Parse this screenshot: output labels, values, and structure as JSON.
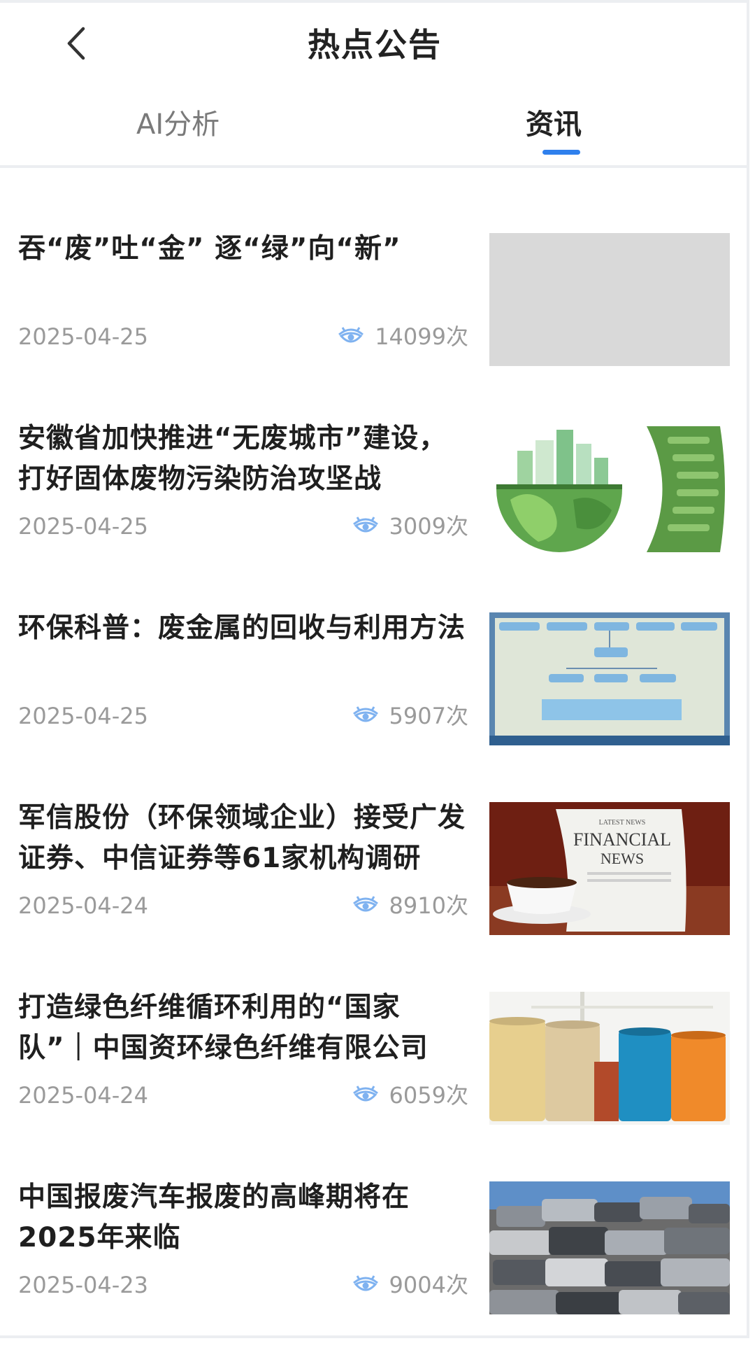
{
  "header": {
    "title": "热点公告",
    "back_icon": "chevron-left-icon"
  },
  "tabs": [
    {
      "label": "AI分析",
      "active": false
    },
    {
      "label": "资讯",
      "active": true
    }
  ],
  "colors": {
    "accent": "#2f80ed",
    "title_text": "#1f1f1f",
    "meta_text": "#9a9a9a"
  },
  "news": [
    {
      "title": "吞“废”吐“金” 逐“绿”向“新”",
      "date": "2025-04-25",
      "views": "14099次",
      "thumbnail": "blank-placeholder"
    },
    {
      "title": "安徽省加快推进“无废城市”建设，打好固体废物污染防治攻坚战",
      "date": "2025-04-25",
      "views": "3009次",
      "thumbnail": "green-globe-city-illustration"
    },
    {
      "title": "环保科普：废金属的回收与利用方法",
      "date": "2025-04-25",
      "views": "5907次",
      "thumbnail": "flowchart-diagram"
    },
    {
      "title": "军信股份（环保领域企业）接受广发证券、中信证券等61家机构调研",
      "date": "2025-04-24",
      "views": "8910次",
      "thumbnail": "financial-news-coffee"
    },
    {
      "title": "打造绿色纤维循环利用的“国家队”｜中国资环绿色纤维有限公司",
      "date": "2025-04-24",
      "views": "6059次",
      "thumbnail": "yarn-spools"
    },
    {
      "title": "中国报废汽车报废的高峰期将在 2025年来临",
      "date": "2025-04-23",
      "views": "9004次",
      "thumbnail": "scrap-car-pile"
    }
  ],
  "thumbnail_text": {
    "financial_news": [
      "LATEST NEWS",
      "FINANCIAL",
      "NEWS"
    ]
  }
}
